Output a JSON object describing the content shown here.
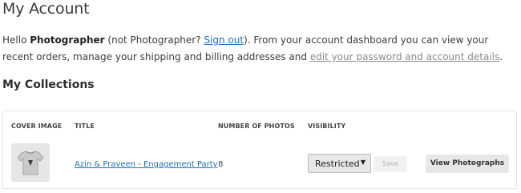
{
  "page": {
    "title": "My Account"
  },
  "intro": {
    "hello": "Hello ",
    "username": "Photographer",
    "not_prefix": " (not Photographer? ",
    "sign_out": "Sign out",
    "middle": "). From your account dashboard you can view your recent orders, manage your shipping and billing addresses and ",
    "edit_link": "edit your password and account details",
    "end": "."
  },
  "collections": {
    "heading": "My Collections",
    "headers": {
      "cover": "COVER IMAGE",
      "title": "TITLE",
      "count": "NUMBER OF PHOTOS",
      "visibility": "VISIBILITY"
    },
    "rows": [
      {
        "cover_icon": "tshirt-icon",
        "title": "Azin & Praveen - Engagement Party",
        "count": "8",
        "visibility": "Restricted",
        "save_label": "Save",
        "view_label": "View Photographs"
      }
    ]
  }
}
